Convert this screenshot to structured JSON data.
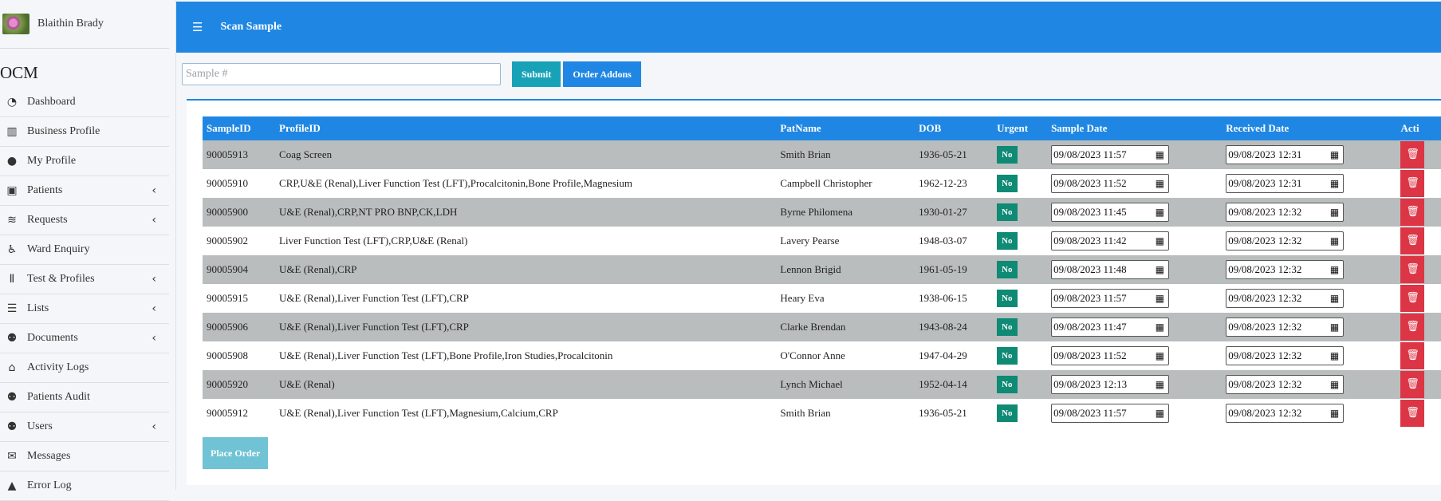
{
  "user": {
    "name": "Blaithin Brady"
  },
  "brand": "OCM",
  "sidebar": {
    "items": [
      {
        "label": "Dashboard",
        "icon": "dashboard-icon",
        "has_submenu": false
      },
      {
        "label": "Business Profile",
        "icon": "building-icon",
        "has_submenu": false
      },
      {
        "label": "My Profile",
        "icon": "user-icon",
        "has_submenu": false
      },
      {
        "label": "Patients",
        "icon": "patient-card-icon",
        "has_submenu": true
      },
      {
        "label": "Requests",
        "icon": "database-icon",
        "has_submenu": true
      },
      {
        "label": "Ward Enquiry",
        "icon": "wheelchair-icon",
        "has_submenu": false
      },
      {
        "label": "Test & Profiles",
        "icon": "vials-icon",
        "has_submenu": true
      },
      {
        "label": "Lists",
        "icon": "list-icon",
        "has_submenu": true
      },
      {
        "label": "Documents",
        "icon": "users-icon",
        "has_submenu": true
      },
      {
        "label": "Activity Logs",
        "icon": "warehouse-icon",
        "has_submenu": false
      },
      {
        "label": "Patients Audit",
        "icon": "users-icon",
        "has_submenu": false
      },
      {
        "label": "Users",
        "icon": "users-icon",
        "has_submenu": true
      },
      {
        "label": "Messages",
        "icon": "envelope-icon",
        "has_submenu": false
      },
      {
        "label": "Error Log",
        "icon": "warning-icon",
        "has_submenu": false
      }
    ]
  },
  "header": {
    "title": "Scan Sample"
  },
  "search": {
    "placeholder": "Sample #",
    "value": ""
  },
  "buttons": {
    "submit": "Submit",
    "order_addons": "Order Addons",
    "place_order": "Place Order"
  },
  "table": {
    "columns": [
      "SampleID",
      "ProfileID",
      "PatName",
      "DOB",
      "Urgent",
      "Sample Date",
      "Received Date",
      "Acti"
    ],
    "rows": [
      {
        "sample_id": "90005913",
        "profile": "Coag Screen",
        "name": "Smith Brian",
        "dob": "1936-05-21",
        "urgent": "No",
        "sample_date": "09/08/2023 11:57",
        "received_date": "09/08/2023 12:31"
      },
      {
        "sample_id": "90005910",
        "profile": "CRP,U&E (Renal),Liver Function Test (LFT),Procalcitonin,Bone Profile,Magnesium",
        "name": "Campbell Christopher",
        "dob": "1962-12-23",
        "urgent": "No",
        "sample_date": "09/08/2023 11:52",
        "received_date": "09/08/2023 12:31"
      },
      {
        "sample_id": "90005900",
        "profile": "U&E (Renal),CRP,NT PRO BNP,CK,LDH",
        "name": "Byrne Philomena",
        "dob": "1930-01-27",
        "urgent": "No",
        "sample_date": "09/08/2023 11:45",
        "received_date": "09/08/2023 12:32"
      },
      {
        "sample_id": "90005902",
        "profile": "Liver Function Test (LFT),CRP,U&E (Renal)",
        "name": "Lavery Pearse",
        "dob": "1948-03-07",
        "urgent": "No",
        "sample_date": "09/08/2023 11:42",
        "received_date": "09/08/2023 12:32"
      },
      {
        "sample_id": "90005904",
        "profile": "U&E (Renal),CRP",
        "name": "Lennon Brigid",
        "dob": "1961-05-19",
        "urgent": "No",
        "sample_date": "09/08/2023 11:48",
        "received_date": "09/08/2023 12:32"
      },
      {
        "sample_id": "90005915",
        "profile": "U&E (Renal),Liver Function Test (LFT),CRP",
        "name": "Heary Eva",
        "dob": "1938-06-15",
        "urgent": "No",
        "sample_date": "09/08/2023 11:57",
        "received_date": "09/08/2023 12:32"
      },
      {
        "sample_id": "90005906",
        "profile": "U&E (Renal),Liver Function Test (LFT),CRP",
        "name": "Clarke Brendan",
        "dob": "1943-08-24",
        "urgent": "No",
        "sample_date": "09/08/2023 11:47",
        "received_date": "09/08/2023 12:32"
      },
      {
        "sample_id": "90005908",
        "profile": "U&E (Renal),Liver Function Test (LFT),Bone Profile,Iron Studies,Procalcitonin",
        "name": "O'Connor Anne",
        "dob": "1947-04-29",
        "urgent": "No",
        "sample_date": "09/08/2023 11:52",
        "received_date": "09/08/2023 12:32"
      },
      {
        "sample_id": "90005920",
        "profile": "U&E (Renal)",
        "name": "Lynch Michael",
        "dob": "1952-04-14",
        "urgent": "No",
        "sample_date": "09/08/2023 12:13",
        "received_date": "09/08/2023 12:32"
      },
      {
        "sample_id": "90005912",
        "profile": "U&E (Renal),Liver Function Test (LFT),Magnesium,Calcium,CRP",
        "name": "Smith Brian",
        "dob": "1936-05-21",
        "urgent": "No",
        "sample_date": "09/08/2023 11:57",
        "received_date": "09/08/2023 12:32"
      }
    ]
  },
  "colors": {
    "primary": "#1f87e3",
    "info": "#17a2b8",
    "success": "#0f8a74",
    "danger": "#dc3545",
    "row_alt": "#b9bdbe"
  }
}
